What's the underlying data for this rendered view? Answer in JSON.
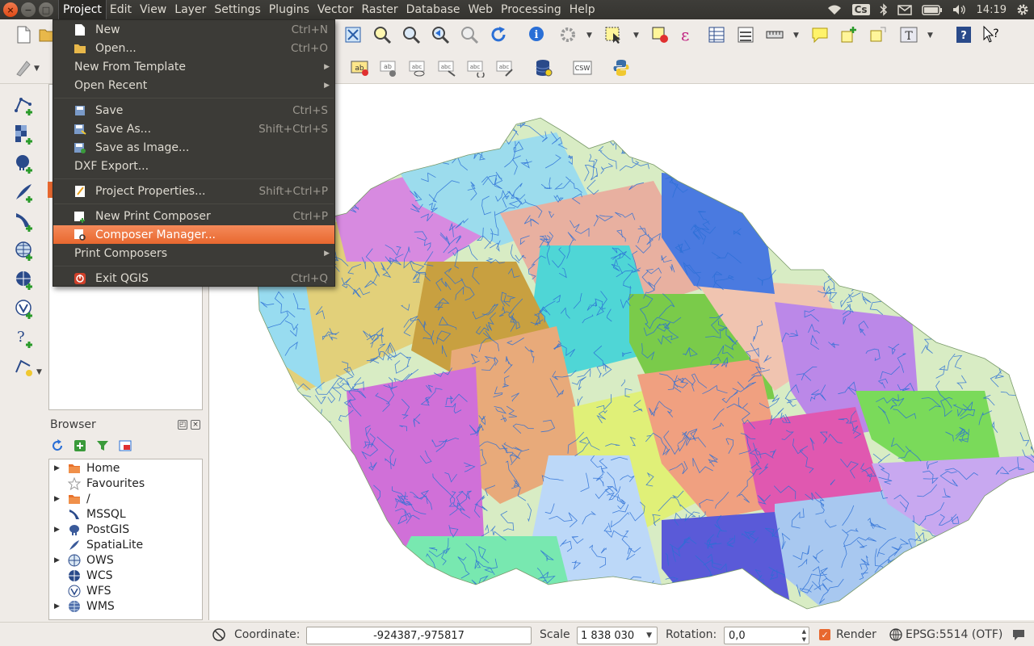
{
  "menubar": {
    "window_controls": {
      "close": "×",
      "minimize": "−",
      "maximize": "□"
    },
    "menus": [
      "Project",
      "Edit",
      "View",
      "Layer",
      "Settings",
      "Plugins",
      "Vector",
      "Raster",
      "Database",
      "Web",
      "Processing",
      "Help"
    ],
    "active_menu": "Project",
    "tray": {
      "keyboard": "Cs",
      "clock": "14:19"
    }
  },
  "project_menu": {
    "items": [
      {
        "label": "New",
        "shortcut": "Ctrl+N",
        "icon": "new-document-icon"
      },
      {
        "label": "Open...",
        "shortcut": "Ctrl+O",
        "icon": "folder-open-icon"
      },
      {
        "label": "New From Template",
        "submenu": true
      },
      {
        "label": "Open Recent",
        "submenu": true
      },
      {
        "label": "Save",
        "shortcut": "Ctrl+S",
        "icon": "save-icon"
      },
      {
        "label": "Save As...",
        "shortcut": "Shift+Ctrl+S",
        "icon": "save-as-icon"
      },
      {
        "label": "Save as Image...",
        "icon": "save-image-icon"
      },
      {
        "label": "DXF Export..."
      },
      {
        "label": "Project Properties...",
        "shortcut": "Shift+Ctrl+P",
        "icon": "project-properties-icon"
      },
      {
        "label": "New Print Composer",
        "shortcut": "Ctrl+P",
        "icon": "new-composer-icon"
      },
      {
        "label": "Composer Manager...",
        "icon": "composer-manager-icon",
        "highlighted": true
      },
      {
        "label": "Print Composers",
        "submenu": true
      },
      {
        "label": "Exit QGIS",
        "shortcut": "Ctrl+Q",
        "icon": "exit-icon"
      }
    ]
  },
  "browser": {
    "title": "Browser",
    "items": [
      {
        "label": "Home",
        "expandable": true,
        "icon": "folder-home-icon"
      },
      {
        "label": "Favourites",
        "expandable": false,
        "icon": "star-icon"
      },
      {
        "label": "/",
        "expandable": true,
        "icon": "folder-icon"
      },
      {
        "label": "MSSQL",
        "expandable": false,
        "icon": "mssql-icon"
      },
      {
        "label": "PostGIS",
        "expandable": true,
        "icon": "postgis-elephant-icon"
      },
      {
        "label": "SpatiaLite",
        "expandable": false,
        "icon": "spatialite-feather-icon"
      },
      {
        "label": "OWS",
        "expandable": true,
        "icon": "globe-icon"
      },
      {
        "label": "WCS",
        "expandable": false,
        "icon": "wcs-globe-icon"
      },
      {
        "label": "WFS",
        "expandable": false,
        "icon": "wfs-globe-icon"
      },
      {
        "label": "WMS",
        "expandable": true,
        "icon": "wms-globe-icon"
      }
    ]
  },
  "statusbar": {
    "coordinate_label": "Coordinate:",
    "coordinate_value": "-924387,-975817",
    "scale_label": "Scale",
    "scale_value": "1 838 030",
    "rotation_label": "Rotation:",
    "rotation_value": "0,0",
    "render_label": "Render",
    "render_checked": true,
    "crs": "EPSG:5514 (OTF)"
  },
  "colors": {
    "menubar_bg": "#3c3b37",
    "menu_highlight": "#e8682f",
    "river_blue": "#2a6fd6"
  }
}
